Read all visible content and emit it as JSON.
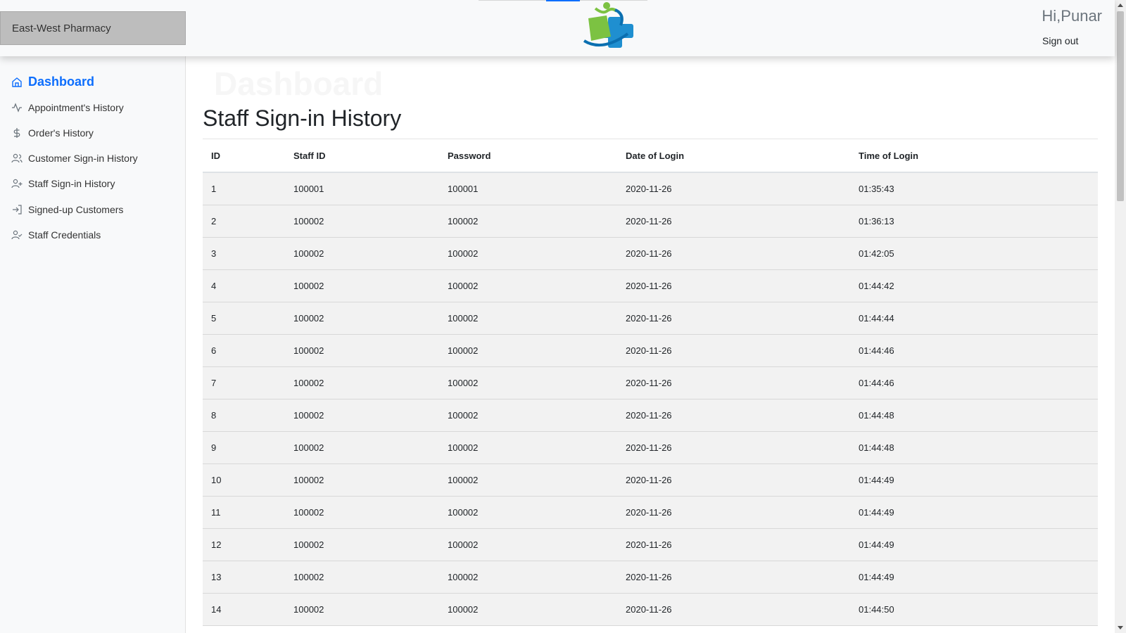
{
  "header": {
    "brand": "East-West Pharmacy",
    "greeting": "Hi,Punar",
    "signout_label": "Sign out",
    "logo_icon": "pharmacy-logo-icon"
  },
  "sidebar": {
    "items": [
      {
        "label": "Dashboard",
        "icon": "home-icon",
        "active": true
      },
      {
        "label": "Appointment's History",
        "icon": "activity-icon"
      },
      {
        "label": "Order's History",
        "icon": "dollar-icon"
      },
      {
        "label": "Customer Sign-in History",
        "icon": "users-icon"
      },
      {
        "label": "Staff Sign-in History",
        "icon": "user-plus-icon"
      },
      {
        "label": "Signed-up Customers",
        "icon": "log-in-icon"
      },
      {
        "label": "Staff Credentials",
        "icon": "user-check-icon"
      }
    ]
  },
  "main": {
    "ghost_title": "Dashboard",
    "title": "Staff Sign-in History",
    "table": {
      "headers": [
        "ID",
        "Staff ID",
        "Password",
        "Date of Login",
        "Time of Login"
      ],
      "rows": [
        [
          "1",
          "100001",
          "100001",
          "2020-11-26",
          "01:35:43"
        ],
        [
          "2",
          "100002",
          "100002",
          "2020-11-26",
          "01:36:13"
        ],
        [
          "3",
          "100002",
          "100002",
          "2020-11-26",
          "01:42:05"
        ],
        [
          "4",
          "100002",
          "100002",
          "2020-11-26",
          "01:44:42"
        ],
        [
          "5",
          "100002",
          "100002",
          "2020-11-26",
          "01:44:44"
        ],
        [
          "6",
          "100002",
          "100002",
          "2020-11-26",
          "01:44:46"
        ],
        [
          "7",
          "100002",
          "100002",
          "2020-11-26",
          "01:44:46"
        ],
        [
          "8",
          "100002",
          "100002",
          "2020-11-26",
          "01:44:48"
        ],
        [
          "9",
          "100002",
          "100002",
          "2020-11-26",
          "01:44:48"
        ],
        [
          "10",
          "100002",
          "100002",
          "2020-11-26",
          "01:44:49"
        ],
        [
          "11",
          "100002",
          "100002",
          "2020-11-26",
          "01:44:49"
        ],
        [
          "12",
          "100002",
          "100002",
          "2020-11-26",
          "01:44:49"
        ],
        [
          "13",
          "100002",
          "100002",
          "2020-11-26",
          "01:44:49"
        ],
        [
          "14",
          "100002",
          "100002",
          "2020-11-26",
          "01:44:50"
        ]
      ]
    }
  },
  "colors": {
    "accent": "#0d6efd",
    "navbar_bg": "#f8f9fa",
    "brand_bg": "#bdbdbd",
    "row_bg": "#f2f2f2",
    "logo_green": "#7cc242",
    "logo_blue": "#1f8fd0"
  }
}
